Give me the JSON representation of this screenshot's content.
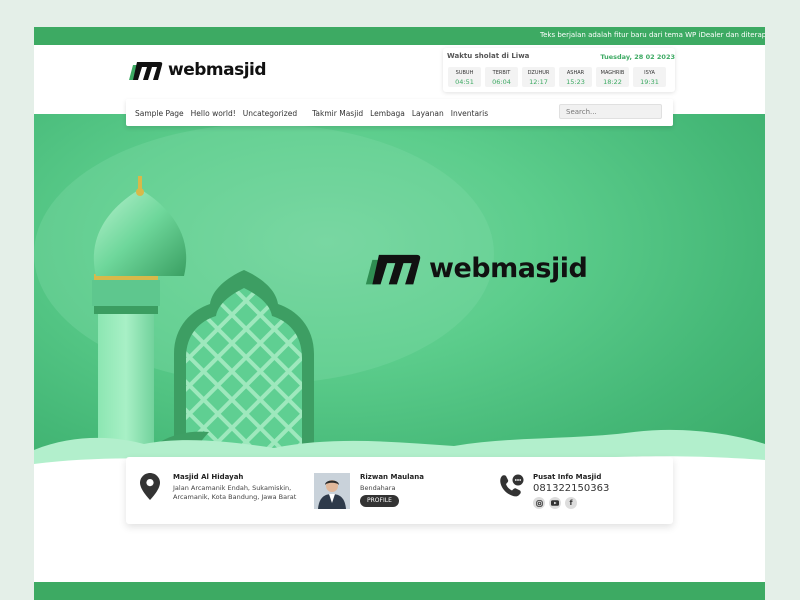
{
  "ticker": {
    "text": "Teks berjalan adalah fitur baru dari tema WP iDealer dan diterapkan sejak ve"
  },
  "brand": {
    "name": "webmasjid"
  },
  "prayer": {
    "location": "Waktu sholat di Liwa",
    "date": "Tuesday, 28 02 2023",
    "times": [
      {
        "name": "SUBUH",
        "time": "04:51"
      },
      {
        "name": "TERBIT",
        "time": "06:04"
      },
      {
        "name": "DZUHUR",
        "time": "12:17"
      },
      {
        "name": "ASHAR",
        "time": "15:23"
      },
      {
        "name": "MAGHRIB",
        "time": "18:22"
      },
      {
        "name": "ISYA",
        "time": "19:31"
      }
    ]
  },
  "nav": {
    "items": [
      "Sample Page",
      "Hello world!",
      "Uncategorized",
      "Takmir Masjid",
      "Lembaga",
      "Layanan",
      "Inventaris"
    ],
    "search_placeholder": "Search..."
  },
  "info": {
    "address_title": "Masjid Al Hidayah",
    "address_text": "Jalan Arcamanik Endah, Sukamiskin, Arcamanik, Kota Bandung, Jawa Barat",
    "person_name": "Rizwan Maulana",
    "person_role": "Bendahara",
    "profile_label": "PROFILE",
    "contact_title": "Pusat Info Masjid",
    "contact_phone": "081322150363",
    "socials": [
      "instagram-icon",
      "youtube-icon",
      "facebook-icon"
    ]
  },
  "colors": {
    "accent": "#3daa63",
    "hero": "#5ccd8c",
    "page_bg": "#e4efe8"
  }
}
